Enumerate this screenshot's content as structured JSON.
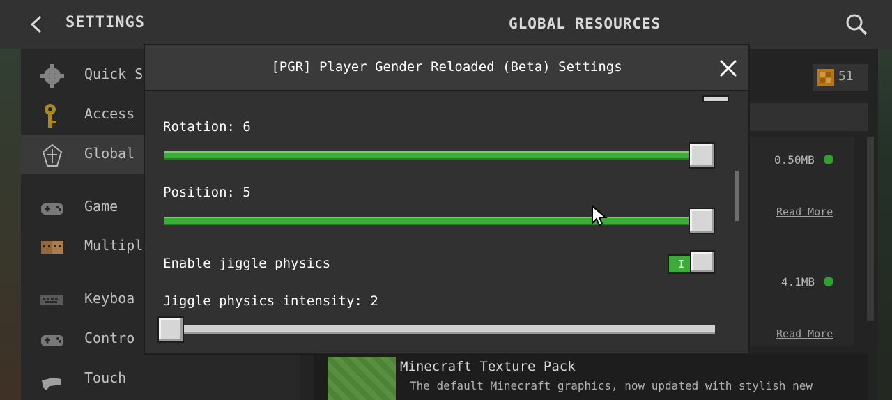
{
  "header": {
    "back_icon": "chevron-left-icon",
    "title": "SETTINGS",
    "section_title": "GLOBAL RESOURCES",
    "search_icon": "search-icon"
  },
  "sidebar": {
    "items": [
      {
        "label": "Quick S",
        "icon": "gear-icon"
      },
      {
        "label": "Access",
        "icon": "key-icon"
      },
      {
        "label": "Global",
        "icon": "global-resources-icon",
        "selected": true
      },
      {
        "label": "Game",
        "icon": "controller-icon"
      },
      {
        "label": "Multipla",
        "icon": "players-icon"
      },
      {
        "label": "Keyboa",
        "icon": "keyboard-icon"
      },
      {
        "label": "Contro",
        "icon": "controller-icon"
      },
      {
        "label": "Touch",
        "icon": "touch-hand-icon"
      }
    ]
  },
  "content": {
    "coin_count": "51",
    "packs": [
      {
        "size": "0.50MB",
        "read_more": "Read More"
      },
      {
        "size": "4.1MB",
        "read_more": "Read More"
      }
    ],
    "texture_pack": {
      "title": "Minecraft Texture Pack",
      "description": "The default Minecraft graphics, now updated with stylish new"
    }
  },
  "modal": {
    "title": "[PGR] Player Gender Reloaded (Beta) Settings",
    "close_icon": "close-icon",
    "settings": [
      {
        "label": "Rotation: 6",
        "type": "slider",
        "fraction": 1.0
      },
      {
        "label": "Position: 5",
        "type": "slider",
        "fraction": 1.0
      },
      {
        "label": "Enable jiggle physics",
        "type": "toggle",
        "enabled": true,
        "toggle_mark": "I"
      },
      {
        "label": "Jiggle physics intensity: 2",
        "type": "slider",
        "fraction": 0.0
      }
    ]
  },
  "colors": {
    "accent_green": "#3cab38",
    "status_dot": "#3dbb3d",
    "panel_bg": "#303030"
  }
}
